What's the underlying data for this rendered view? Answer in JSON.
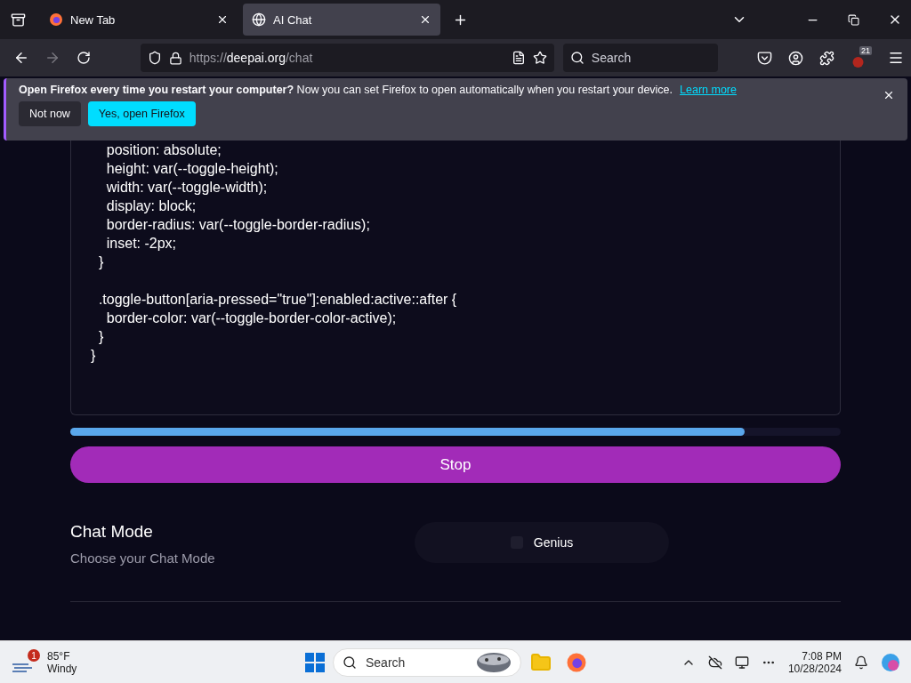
{
  "browser": {
    "tabs": [
      {
        "title": "New Tab",
        "selected": false
      },
      {
        "title": "AI Chat",
        "selected": true
      }
    ],
    "url": {
      "prefix": "https://",
      "host": "deepai.org",
      "path": "/chat"
    },
    "search": {
      "placeholder": "Search"
    },
    "extension_badge": "21"
  },
  "notification": {
    "title": "Open Firefox every time you restart your computer?",
    "message": "Now you can set Firefox to open automatically when you restart your device.",
    "link": "Learn more",
    "buttons": [
      {
        "label": "Not now",
        "kind": "secondary"
      },
      {
        "label": "Yes, open Firefox",
        "kind": "primary"
      }
    ]
  },
  "code_blocks": [
    [
      "    position: absolute;",
      "    height: var(--toggle-height);",
      "    width: var(--toggle-width);",
      "    display: block;",
      "    border-radius: var(--toggle-border-radius);",
      "    inset: -2px;",
      "  }"
    ],
    [
      "  .toggle-button[aria-pressed=\"true\"]:enabled:active::after {",
      "    border-color: var(--toggle-border-color-active);",
      "  }",
      "}"
    ]
  ],
  "progress": {
    "level": 0.875
  },
  "stop_button": "Stop",
  "chat_mode": {
    "title": "Chat Mode",
    "subtitle": "Choose your Chat Mode",
    "options": [
      {
        "label": "Genius",
        "selected": false
      }
    ]
  },
  "taskbar": {
    "weather": {
      "badge": "1",
      "temperature": "85°F",
      "condition": "Windy"
    },
    "search": {
      "placeholder": "Search"
    },
    "time": "7:08 PM",
    "date": "10/28/2024"
  }
}
